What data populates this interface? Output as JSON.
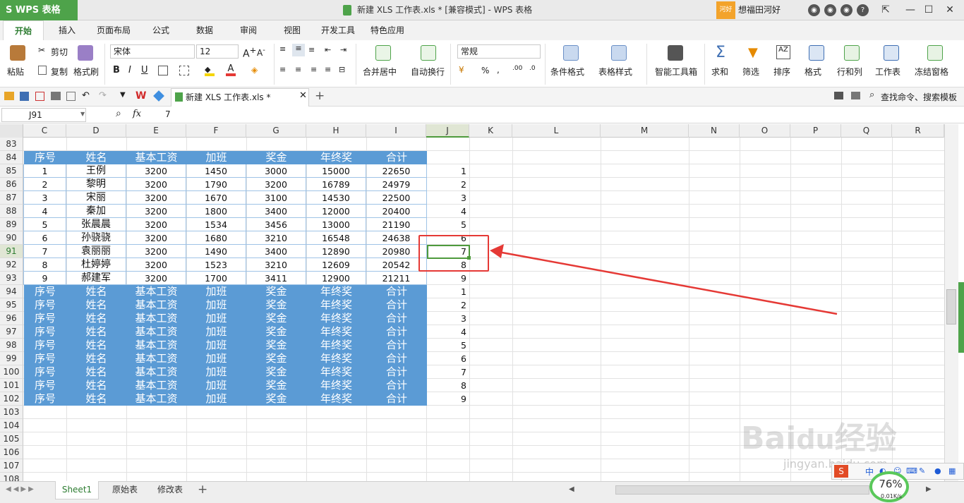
{
  "title_bar": {
    "app_button": "S WPS 表格",
    "window_title": "新建 XLS 工作表.xls * [兼容模式] - WPS 表格",
    "greet_badge": "河好",
    "greet_text": "想福田河好"
  },
  "ribbon_tabs": [
    "开始",
    "插入",
    "页面布局",
    "公式",
    "数据",
    "审阅",
    "视图",
    "开发工具",
    "特色应用"
  ],
  "ribbon": {
    "paste": "粘贴",
    "cut": "剪切",
    "copy": "复制",
    "format_painter": "格式刷",
    "font_name": "宋体",
    "font_size": "12",
    "merge_center": "合并居中",
    "wrap_text": "自动换行",
    "number_format": "常规",
    "percent": "%",
    "conditional_format": "条件格式",
    "table_style": "表格样式",
    "smart_toolbox": "智能工具箱",
    "sum": "求和",
    "filter": "筛选",
    "sort": "排序",
    "format": "格式",
    "row_col": "行和列",
    "worksheet": "工作表",
    "freeze": "冻结窗格"
  },
  "quick_access": {
    "doc_tab": "新建 XLS 工作表.xls *",
    "search": "查找命令、搜索模板"
  },
  "formula_bar": {
    "name_box": "J91",
    "fx": "fx",
    "value": "7"
  },
  "columns": [
    "C",
    "D",
    "E",
    "F",
    "G",
    "H",
    "I",
    "J",
    "K",
    "L",
    "M",
    "N",
    "O",
    "P",
    "Q",
    "R"
  ],
  "row_numbers": [
    "83",
    "84",
    "85",
    "86",
    "87",
    "88",
    "89",
    "90",
    "91",
    "92",
    "93",
    "94",
    "95",
    "96",
    "97",
    "98",
    "99",
    "100",
    "101",
    "102",
    "103",
    "104",
    "105",
    "106",
    "107",
    "108"
  ],
  "table_header": [
    "序号",
    "姓名",
    "基本工资",
    "加班",
    "奖金",
    "年终奖",
    "合计"
  ],
  "table_rows": [
    [
      "1",
      "王例",
      "3200",
      "1450",
      "3000",
      "15000",
      "22650",
      "1"
    ],
    [
      "2",
      "黎明",
      "3200",
      "1790",
      "3200",
      "16789",
      "24979",
      "2"
    ],
    [
      "3",
      "宋丽",
      "3200",
      "1670",
      "3100",
      "14530",
      "22500",
      "3"
    ],
    [
      "4",
      "秦加",
      "3200",
      "1800",
      "3400",
      "12000",
      "20400",
      "4"
    ],
    [
      "5",
      "张晨晨",
      "3200",
      "1534",
      "3456",
      "13000",
      "21190",
      "5"
    ],
    [
      "6",
      "孙骁骁",
      "3200",
      "1680",
      "3210",
      "16548",
      "24638",
      "6"
    ],
    [
      "7",
      "袁丽丽",
      "3200",
      "1490",
      "3400",
      "12890",
      "20980",
      "7"
    ],
    [
      "8",
      "杜婷婷",
      "3200",
      "1523",
      "3210",
      "12609",
      "20542",
      "8"
    ],
    [
      "9",
      "郝建军",
      "3200",
      "1700",
      "3411",
      "12900",
      "21211",
      "9"
    ]
  ],
  "repeat_j": [
    "1",
    "2",
    "3",
    "4",
    "5",
    "6",
    "7",
    "8",
    "9"
  ],
  "sheet_tabs": [
    "Sheet1",
    "原始表",
    "修改表"
  ],
  "status": {
    "zoom": "76%",
    "speed": "0.01K/s"
  },
  "colors": {
    "header_blue": "#5b9bd5",
    "accent_green": "#4ea34a",
    "highlight_red": "#e53935"
  }
}
